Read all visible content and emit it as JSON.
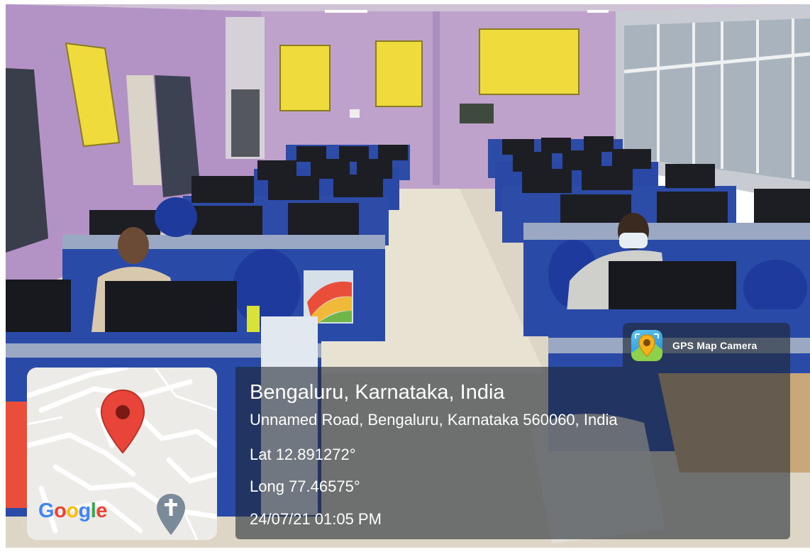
{
  "badge": {
    "app_name": "GPS Map Camera",
    "icon": "gps-map-camera-app-icon"
  },
  "location": {
    "title": "Bengaluru, Karnataka, India",
    "address": "Unnamed Road, Bengaluru, Karnataka 560060, India",
    "latitude": "Lat 12.891272°",
    "longitude": "Long 77.46575°",
    "timestamp": "24/07/21 01:05 PM"
  },
  "map": {
    "provider": "Google",
    "pin_icon": "location-pin-icon",
    "poi_icon": "church-cross-icon",
    "colors": {
      "pin": "#e8443a",
      "land": "#ecebe7",
      "roads": "#ffffff",
      "poi": "#7a8a99"
    }
  },
  "colors": {
    "wall": "#b89ac8",
    "floor": "#ddd7c9",
    "desk_blue": "#2c4ca8",
    "chair_blue": "#1d3a9c",
    "poster_yellow": "#f2df3e",
    "overlay": "#1e2630"
  }
}
